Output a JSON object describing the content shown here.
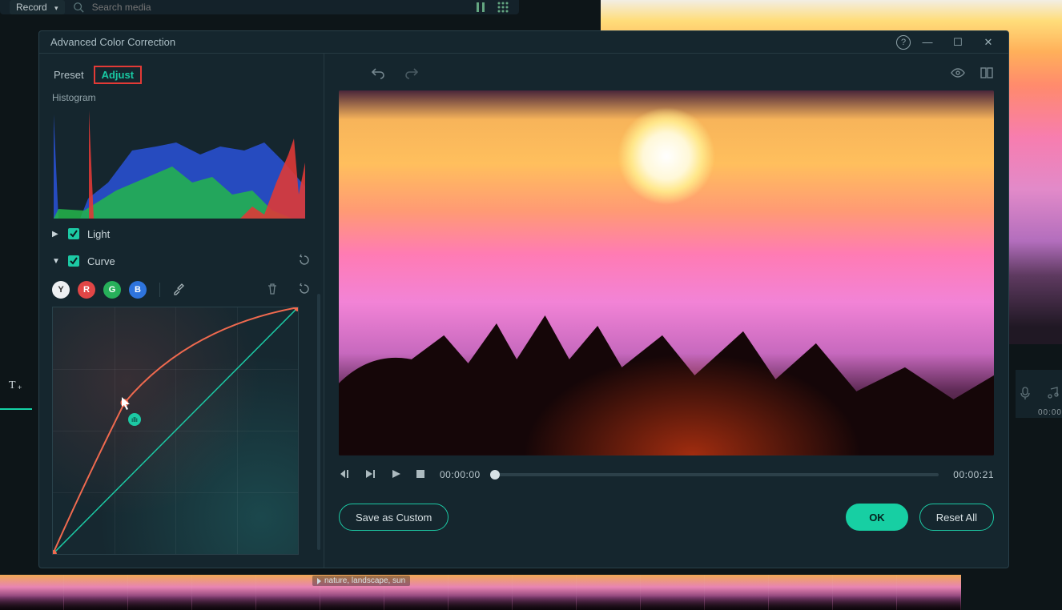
{
  "topbar": {
    "record_label": "Record",
    "search_placeholder": "Search media"
  },
  "dialog": {
    "title": "Advanced Color Correction",
    "tabs": {
      "preset": "Preset",
      "adjust": "Adjust"
    },
    "histogram_label": "Histogram",
    "sections": {
      "light": "Light",
      "curve": "Curve"
    },
    "channels": {
      "y": "Y",
      "r": "R",
      "g": "G",
      "b": "B"
    },
    "playback": {
      "current": "00:00:00",
      "total": "00:00:21"
    },
    "buttons": {
      "save_custom": "Save as Custom",
      "ok": "OK",
      "reset_all": "Reset All"
    }
  },
  "timeline": {
    "right_time": "00:00",
    "clip_name": "nature, landscape, sun"
  }
}
